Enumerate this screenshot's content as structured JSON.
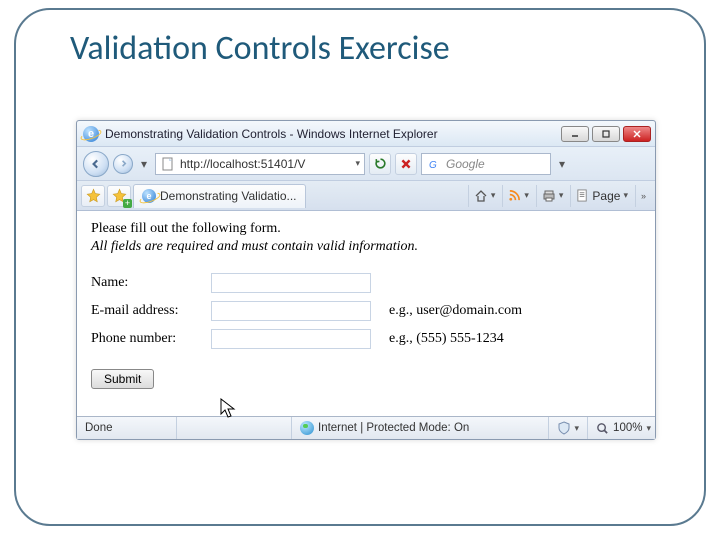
{
  "slide": {
    "title": "Validation Controls Exercise"
  },
  "window": {
    "title": "Demonstrating Validation Controls - Windows Internet Explorer",
    "url": "http://localhost:51401/V",
    "search_placeholder": "Google",
    "tab_title": "Demonstrating Validatio...",
    "page_menu": "Page",
    "chevrons": "»"
  },
  "page": {
    "instr1": "Please fill out the following form.",
    "instr2": "All fields are required and must contain valid information.",
    "labels": {
      "name": "Name:",
      "email": "E-mail address:",
      "phone": "Phone number:"
    },
    "hints": {
      "email": "e.g., user@domain.com",
      "phone": "e.g., (555) 555-1234"
    },
    "submit": "Submit"
  },
  "status": {
    "done": "Done",
    "zone": "Internet | Protected Mode: On",
    "zoom": "100%"
  }
}
